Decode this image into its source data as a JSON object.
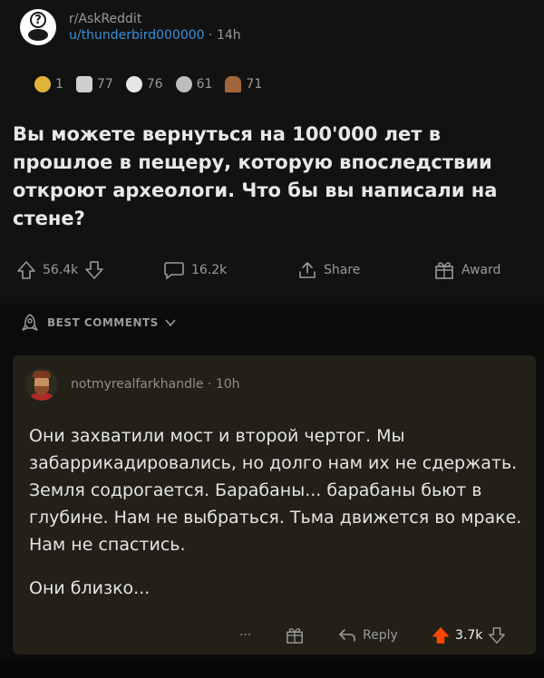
{
  "post": {
    "subreddit": "r/AskReddit",
    "user_prefix": "u/",
    "username": "thunderbird000000",
    "separator": "·",
    "age": "14h",
    "awards": [
      {
        "icon": "gold-award-icon",
        "count": "1",
        "color": "#e0b43a"
      },
      {
        "icon": "hug-award-icon",
        "count": "77",
        "color": "#cfcfcf"
      },
      {
        "icon": "wholesome-award-icon",
        "count": "76",
        "color": "#e6e6e6"
      },
      {
        "icon": "silver-award-icon",
        "count": "61",
        "color": "#bdbdbd"
      },
      {
        "icon": "poop-award-icon",
        "count": "71",
        "color": "#a0663a"
      }
    ],
    "title": "Вы можете вернуться на 100'000 лет в прошлое в пещеру, которую впоследствии откроют археологи. Что бы вы написали на стене?",
    "actions": {
      "score": "56.4k",
      "comments": "16.2k",
      "share": "Share",
      "award": "Award"
    }
  },
  "sort": {
    "label": "BEST COMMENTS"
  },
  "comment": {
    "author": "notmyrealfarkhandle",
    "separator": "·",
    "age": "10h",
    "paragraph1": "Они захватили мост и второй чертог. Мы забаррикадировались, но долго нам их не сдержать. Земля содрогается. Барабаны... барабаны бьют в глубине. Нам не выбраться. Тьма движется во мраке. Нам не спастись.",
    "paragraph2": "Они близко...",
    "actions": {
      "more": "···",
      "reply": "Reply",
      "score": "3.7k"
    }
  },
  "colors": {
    "background": "#0b0b0b",
    "post_bg": "#121212",
    "comment_bg": "#222017",
    "username": "#3f8fd8",
    "upvote_active": "#ff4500"
  }
}
